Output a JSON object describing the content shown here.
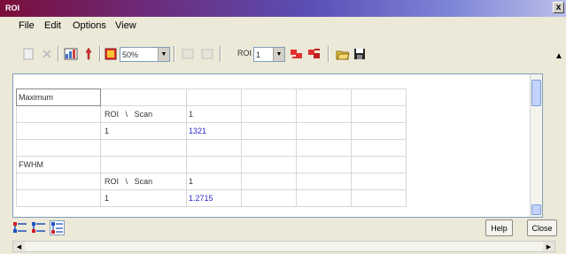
{
  "window": {
    "title": "ROI",
    "close_label": "x"
  },
  "menu": {
    "items": [
      "File",
      "Edit",
      "Options",
      "View"
    ]
  },
  "toolbar": {
    "zoom": {
      "value": "50%"
    },
    "roi": {
      "label": "ROI",
      "value": "1"
    }
  },
  "grid": {
    "sections": [
      {
        "header": "Maximum",
        "row_header": [
          "ROI",
          "\\",
          "Scan"
        ],
        "scan_value": "1",
        "roi_value": "1",
        "result": "1321"
      },
      {
        "header": "FWHM",
        "row_header": [
          "ROI",
          "\\",
          "Scan"
        ],
        "scan_value": "1",
        "roi_value": "1",
        "result": "1.2715"
      }
    ]
  },
  "buttons": {
    "help": "Help",
    "close": "Close"
  },
  "colors": {
    "value_text": "#2a2ad0",
    "title_gradient_start": "#7a0e3a",
    "title_gradient_end": "#b9bfe8"
  }
}
